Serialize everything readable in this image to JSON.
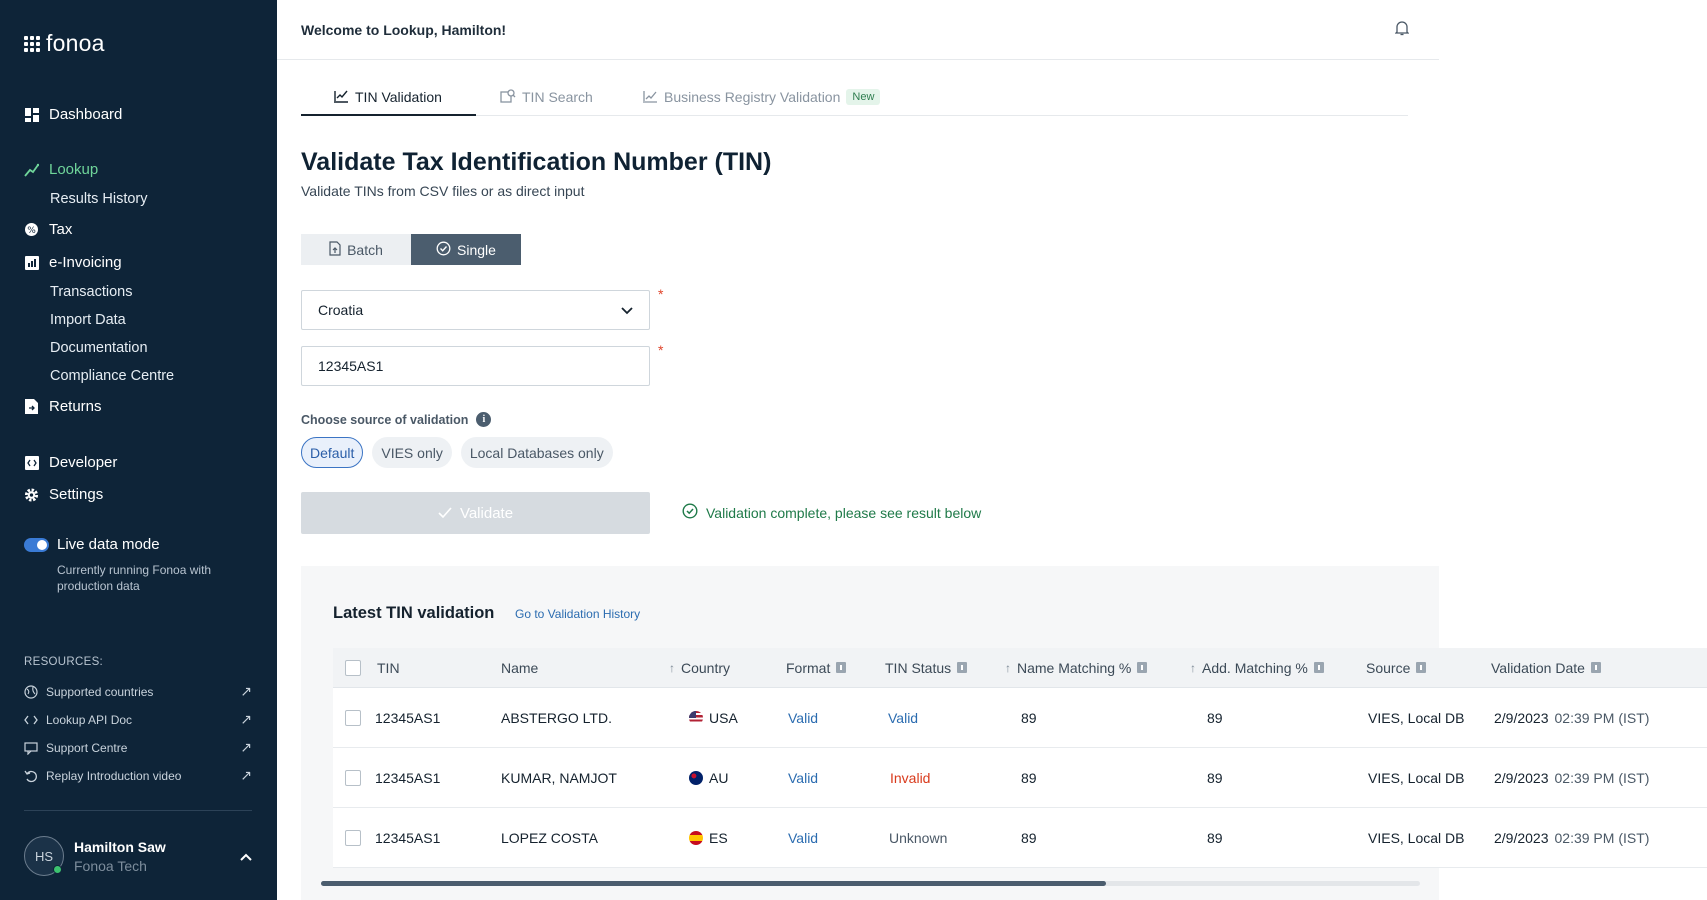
{
  "brand": {
    "name": "fonoa"
  },
  "sidebar": {
    "nav": [
      {
        "label": "Dashboard",
        "icon": "dashboard-icon"
      },
      {
        "label": "Lookup",
        "icon": "lookup-icon",
        "active": true
      },
      {
        "label": "Results History"
      },
      {
        "label": "Tax",
        "icon": "tax-icon"
      },
      {
        "label": "e-Invoicing",
        "icon": "invoice-icon"
      },
      {
        "label": "Transactions"
      },
      {
        "label": "Import Data"
      },
      {
        "label": "Documentation"
      },
      {
        "label": "Compliance Centre"
      },
      {
        "label": "Returns",
        "icon": "returns-icon"
      },
      {
        "label": "Developer",
        "icon": "developer-icon"
      },
      {
        "label": "Settings",
        "icon": "gear-icon"
      }
    ],
    "live_mode": {
      "label": "Live data mode",
      "description": "Currently running Fonoa with production data"
    },
    "resources_title": "RESOURCES:",
    "resources": [
      {
        "label": "Supported countries"
      },
      {
        "label": "Lookup API Doc"
      },
      {
        "label": "Support Centre"
      },
      {
        "label": "Replay Introduction video"
      }
    ],
    "user": {
      "initials": "HS",
      "name": "Hamilton Saw",
      "org": "Fonoa Tech"
    }
  },
  "header": {
    "welcome": "Welcome to Lookup, Hamilton!"
  },
  "tabs": [
    {
      "label": "TIN Validation"
    },
    {
      "label": "TIN Search"
    },
    {
      "label": "Business Registry Validation",
      "badge": "New"
    }
  ],
  "page": {
    "title": "Validate Tax Identification Number (TIN)",
    "subtitle": "Validate TINs from CSV files or as direct input"
  },
  "mode": {
    "batch": "Batch",
    "single": "Single"
  },
  "form": {
    "country": "Croatia",
    "tin_value": "12345AS1",
    "required_mark": "*",
    "source_label": "Choose source of validation",
    "sources": [
      "Default",
      "VIES only",
      "Local Databases only"
    ],
    "validate_label": "Validate",
    "success_message": "Validation complete, please see result below"
  },
  "results": {
    "title": "Latest TIN validation",
    "history_link": "Go to Validation History",
    "columns": {
      "tin": "TIN",
      "name": "Name",
      "country": "Country",
      "format": "Format",
      "tin_status": "TIN Status",
      "name_matching": "Name Matching %",
      "add_matching": "Add. Matching %",
      "source": "Source",
      "validation_date": "Validation Date"
    },
    "rows": [
      {
        "tin": "12345AS1",
        "name": "ABSTERGO LTD.",
        "country": "USA",
        "format": "Valid",
        "status": "Valid",
        "name_match": "89",
        "add_match": "89",
        "source": "VIES, Local DB",
        "date": "2/9/2023",
        "time": "02:39 PM (IST)"
      },
      {
        "tin": "12345AS1",
        "name": "KUMAR, NAMJOT",
        "country": "AU",
        "format": "Valid",
        "status": "Invalid",
        "name_match": "89",
        "add_match": "89",
        "source": "VIES, Local DB",
        "date": "2/9/2023",
        "time": "02:39 PM (IST)"
      },
      {
        "tin": "12345AS1",
        "name": "LOPEZ COSTA",
        "country": "ES",
        "format": "Valid",
        "status": "Unknown",
        "name_match": "89",
        "add_match": "89",
        "source": "VIES, Local DB",
        "date": "2/9/2023",
        "time": "02:39 PM (IST)"
      }
    ]
  },
  "colors": {
    "sidebar": "#0e2438",
    "accent_green": "#6fd59a",
    "link_blue": "#2b6cb0",
    "invalid_red": "#d93a1c"
  }
}
